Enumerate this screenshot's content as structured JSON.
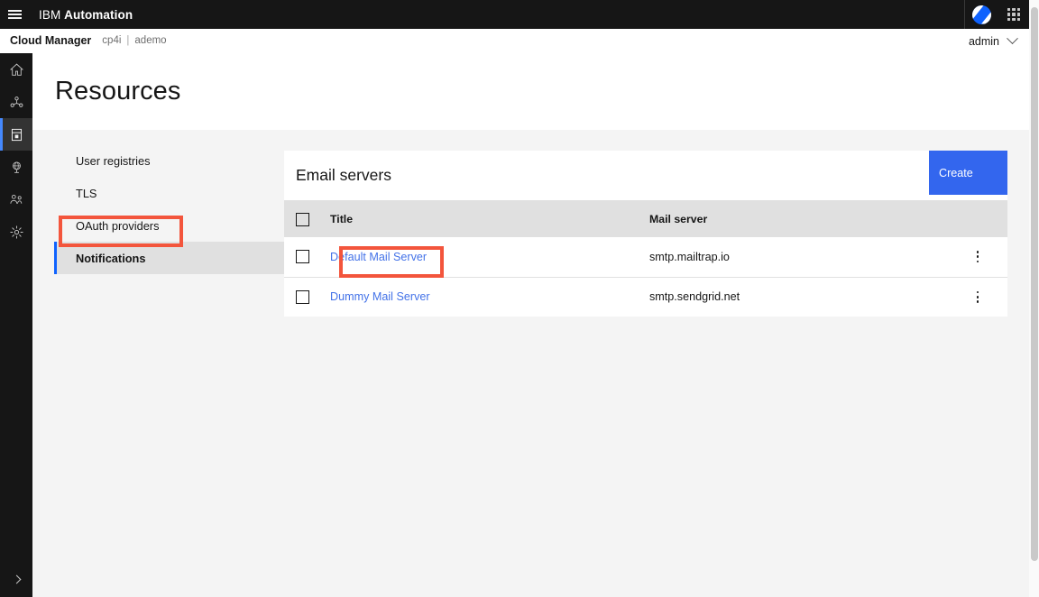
{
  "header": {
    "menu_icon": "hamburger-icon",
    "product_name_light": "IBM",
    "product_name_bold": "Automation",
    "avatar_icon": "user-avatar-icon",
    "app_switcher_icon": "app-grid-icon"
  },
  "subheader": {
    "app_title": "Cloud Manager",
    "namespace": "cp4i",
    "separator": "|",
    "instance": "ademo",
    "user": "admin",
    "chevron_icon": "chevron-down-icon"
  },
  "rail": {
    "items": [
      {
        "name": "home",
        "icon": "home-icon",
        "active": false
      },
      {
        "name": "topology",
        "icon": "group-resource-icon",
        "active": false
      },
      {
        "name": "catalog",
        "icon": "server-catalog-icon",
        "active": true
      },
      {
        "name": "locations",
        "icon": "globe-icon",
        "active": false
      },
      {
        "name": "users",
        "icon": "user-multiple-icon",
        "active": false
      },
      {
        "name": "settings",
        "icon": "gear-icon",
        "active": false
      }
    ],
    "expand_icon": "chevron-right-icon"
  },
  "page": {
    "title": "Resources"
  },
  "secondary_nav": {
    "items": [
      {
        "label": "User registries",
        "selected": false
      },
      {
        "label": "TLS",
        "selected": false
      },
      {
        "label": "OAuth providers",
        "selected": false
      },
      {
        "label": "Notifications",
        "selected": true
      }
    ]
  },
  "card": {
    "title": "Email servers",
    "create_label": "Create",
    "create_color": "#3366ee",
    "table": {
      "select_all_checkbox": "unchecked",
      "columns": [
        "Title",
        "Mail server"
      ],
      "rows": [
        {
          "checked": false,
          "title": "Default Mail Server",
          "mail_server": "smtp.mailtrap.io",
          "overflow_icon": "overflow-menu-vertical-icon"
        },
        {
          "checked": false,
          "title": "Dummy Mail Server",
          "mail_server": "smtp.sendgrid.net",
          "overflow_icon": "overflow-menu-vertical-icon"
        }
      ]
    }
  },
  "annotations": {
    "highlight_color": "#f3553c",
    "boxes": [
      {
        "target": "secondary-nav-notifications"
      },
      {
        "target": "table-link-default-mail-server"
      }
    ]
  }
}
